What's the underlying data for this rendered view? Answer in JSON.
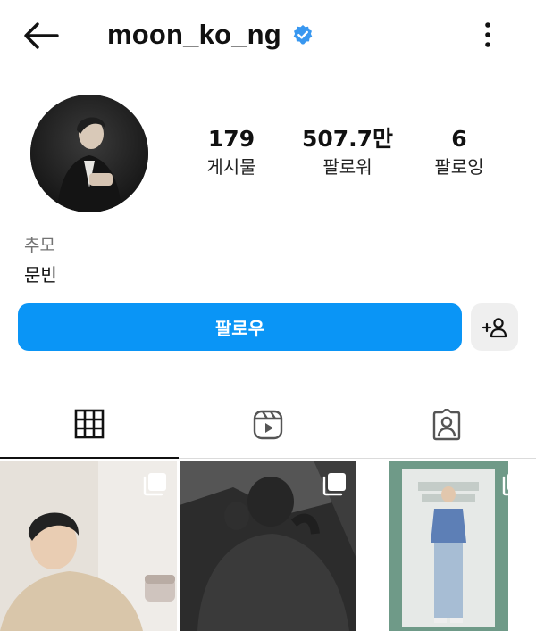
{
  "header": {
    "username": "moon_ko_ng",
    "verified_color": "#3897f0"
  },
  "profile": {
    "stats": {
      "posts_value": "179",
      "posts_label": "게시물",
      "followers_value": "507.7만",
      "followers_label": "팔로워",
      "following_value": "6",
      "following_label": "팔로잉"
    },
    "category": "추모",
    "name": "문빈"
  },
  "actions": {
    "follow_label": "팔로우",
    "follow_color": "#0a95f6"
  },
  "tabs": [
    {
      "name": "grid",
      "icon": "grid-icon",
      "active": true
    },
    {
      "name": "reels",
      "icon": "reels-icon",
      "active": false
    },
    {
      "name": "tagged",
      "icon": "tagged-icon",
      "active": false
    }
  ],
  "posts": [
    {
      "icon": "multiple-photos-icon"
    },
    {
      "icon": "multiple-photos-icon"
    },
    {
      "icon": "multiple-photos-icon"
    }
  ]
}
